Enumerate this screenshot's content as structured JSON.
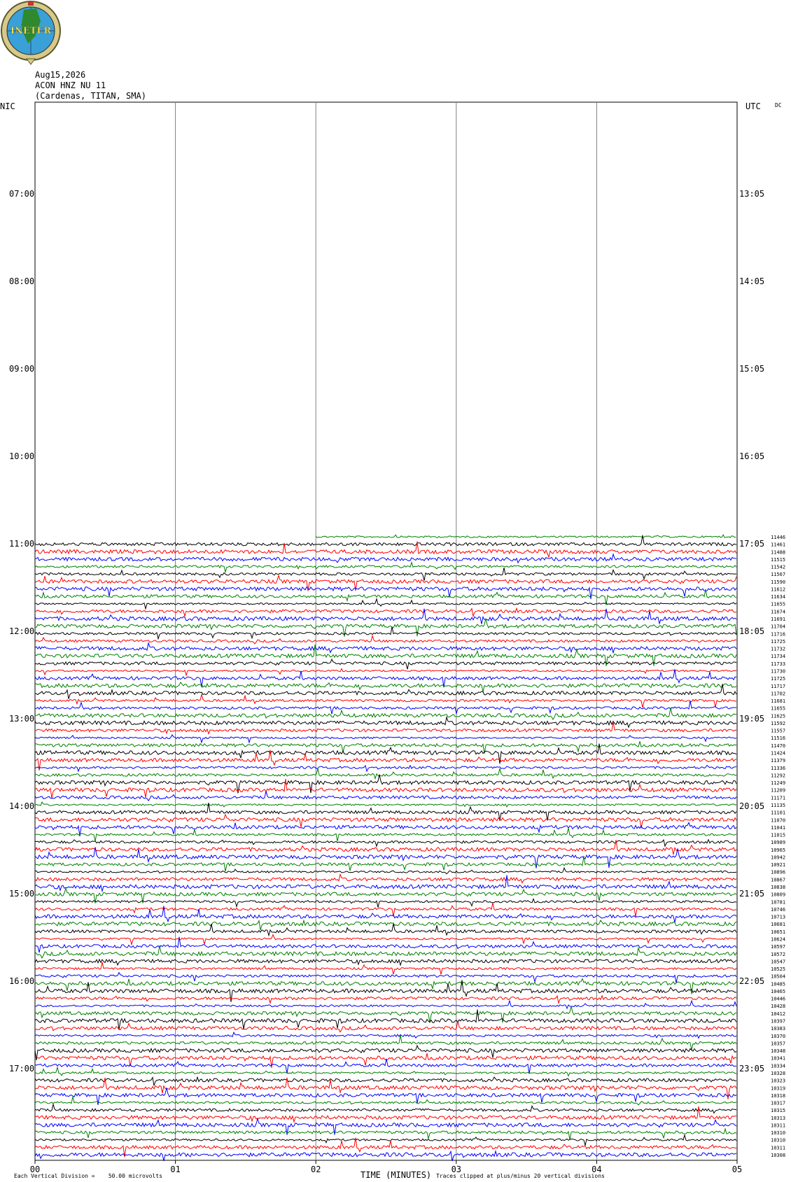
{
  "logo": {
    "text": "INETER"
  },
  "header": {
    "date": "Aug15,2026",
    "station": "ACON HNZ NU 11",
    "location": "(Cardenas, TITAN, SMA)"
  },
  "left_tz": "NIC",
  "right_tz": "UTC",
  "corner_mark": "DC",
  "footer": {
    "scale_note": "Each Vertical Division =    50.00 microvolts",
    "clip_note": "Traces clipped at plus/minus 20 vertical divisions"
  },
  "chart_data": {
    "type": "line",
    "title": "",
    "xlabel": "TIME (MINUTES)",
    "ylabel": "",
    "xlim": [
      0,
      5
    ],
    "x_ticks": [
      "00",
      "01",
      "02",
      "03",
      "04",
      "05"
    ],
    "left_hour_labels": [
      "07:00",
      "08:00",
      "09:00",
      "10:00",
      "11:00",
      "12:00",
      "13:00",
      "14:00",
      "15:00",
      "16:00",
      "17:00"
    ],
    "right_hour_labels": [
      "13:05",
      "14:05",
      "15:05",
      "16:05",
      "17:05",
      "18:05",
      "19:05",
      "20:05",
      "21:05",
      "22:05",
      "23:05"
    ],
    "trace_colors": [
      "#000000",
      "#ff0000",
      "#0000ff",
      "#008000"
    ],
    "first_trace_start_minute": 2.0,
    "trace_count": 84,
    "trace_counts": [
      "11446",
      "11461",
      "11488",
      "11515",
      "11542",
      "11567",
      "11590",
      "11612",
      "11634",
      "11655",
      "11674",
      "11691",
      "11704",
      "11716",
      "11725",
      "11732",
      "11734",
      "11733",
      "11730",
      "11725",
      "11717",
      "11702",
      "11681",
      "11655",
      "11625",
      "11592",
      "11557",
      "11516",
      "11470",
      "11424",
      "11379",
      "11336",
      "11292",
      "11249",
      "11209",
      "11171",
      "11135",
      "11101",
      "11070",
      "11041",
      "11015",
      "10989",
      "10965",
      "10942",
      "10921",
      "10896",
      "10867",
      "10838",
      "10809",
      "10781",
      "10746",
      "10713",
      "10681",
      "10651",
      "10624",
      "10597",
      "10572",
      "10547",
      "10525",
      "10504",
      "10485",
      "10465",
      "10446",
      "10428",
      "10412",
      "10397",
      "10383",
      "10370",
      "10357",
      "10348",
      "10341",
      "10334",
      "10328",
      "10323",
      "10319",
      "10318",
      "10317",
      "10315",
      "10313",
      "10311",
      "10310",
      "10310",
      "10311",
      "10308"
    ]
  }
}
